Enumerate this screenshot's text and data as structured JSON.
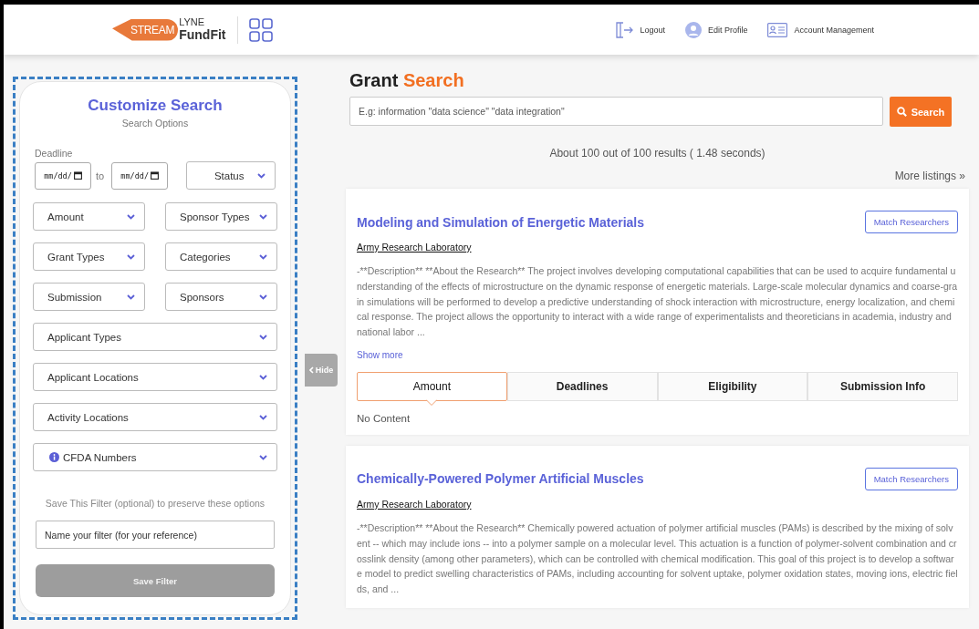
{
  "header": {
    "logo": {
      "brand_first": "STREAM",
      "brand_second": "LYNE",
      "product": "FundFit"
    },
    "nav": [
      {
        "label": "Logout",
        "kind": "logout"
      },
      {
        "label": "Edit Profile",
        "kind": "profile"
      },
      {
        "label": "Account Management",
        "kind": "account"
      }
    ]
  },
  "filters": {
    "title": "Customize Search",
    "subtitle": "Search Options",
    "deadline_label": "Deadline",
    "date_from": "mm/dd/",
    "date_separator": "to",
    "date_to": "mm/dd/",
    "status": "Status",
    "dropdowns": [
      {
        "label": "Amount",
        "kind": "half"
      },
      {
        "label": "Sponsor Types",
        "kind": "half"
      },
      {
        "label": "Grant Types",
        "kind": "half"
      },
      {
        "label": "Categories",
        "kind": "half"
      },
      {
        "label": "Submission",
        "kind": "half"
      },
      {
        "label": "Sponsors",
        "kind": "half"
      },
      {
        "label": "Applicant Types",
        "kind": "full"
      },
      {
        "label": "Applicant Locations",
        "kind": "full"
      },
      {
        "label": "Activity Locations",
        "kind": "full"
      },
      {
        "label": "CFDA Numbers",
        "kind": "info"
      }
    ],
    "save_hint": "Save This Filter (optional) to preserve these options",
    "name_placeholder": "Name your filter (for your reference)",
    "save_button": "Save Filter"
  },
  "hide_toggle": "Hide",
  "search": {
    "title_first": "Grant",
    "title_second": "Search",
    "placeholder": "E.g: information \"data science\" \"data integration\"",
    "button": "Search",
    "results": "About 100 out of 100 results ( 1.48 seconds)",
    "more": "More listings »"
  },
  "grants": [
    {
      "title": "Modeling and Simulation of Energetic Materials",
      "action": "Match Researchers",
      "sponsor": "Army Research Laboratory",
      "description": "-**Description** **About the Research** The project involves developing computational capabilities that can be used to acquire fundamental understanding of the effects of microstructure on the dynamic response of energetic materials. Large-scale molecular dynamics and coarse-grain simulations will be performed to develop a predictive understanding of shock interaction with microstructure, energy localization, and chemical response. The project allows the opportunity to interact with a wide range of experimentalists and theoreticians in academia, industry and national labor ...",
      "show_more": "Show more",
      "tabs": [
        {
          "label": "Amount",
          "selected": true
        },
        {
          "label": "Deadlines",
          "selected": false
        },
        {
          "label": "Eligibility",
          "selected": false
        },
        {
          "label": "Submission Info",
          "selected": false
        }
      ],
      "tab_content": "No Content"
    },
    {
      "title": "Chemically-Powered Polymer Artificial Muscles",
      "action": "Match Researchers",
      "sponsor": "Army Research Laboratory",
      "description": "-**Description** **About the Research** Chemically powered actuation of polymer artificial muscles (PAMs) is described by the mixing of solvent -- which may include ions -- into a polymer sample on a molecular level. This actuation is a function of polymer-solvent combination and crosslink density (among other parameters), which can be controlled with chemical modification. This goal of this project is to develop a software model to predict swelling characteristics of PAMs, including accounting for solvent uptake, polymer oxidation states, moving ions, electric fields, and ..."
    }
  ]
}
